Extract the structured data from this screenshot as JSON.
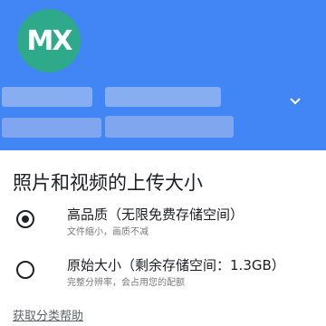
{
  "account": {
    "avatar_text": "MX"
  },
  "header": {
    "background_color": "#4285f4",
    "chevron_icon": "chevron-down-icon"
  },
  "section": {
    "title": "照片和视频的上传大小"
  },
  "options": [
    {
      "label": "高品质（无限免费存储空间）",
      "sublabel": "文件缩小，画质不减",
      "selected": true
    },
    {
      "label": "原始大小（剩余存储空间：1.3GB）",
      "sublabel": "完整分辨率，会占用您的配额",
      "selected": false
    }
  ],
  "help": {
    "link_text": "获取分类帮助"
  }
}
